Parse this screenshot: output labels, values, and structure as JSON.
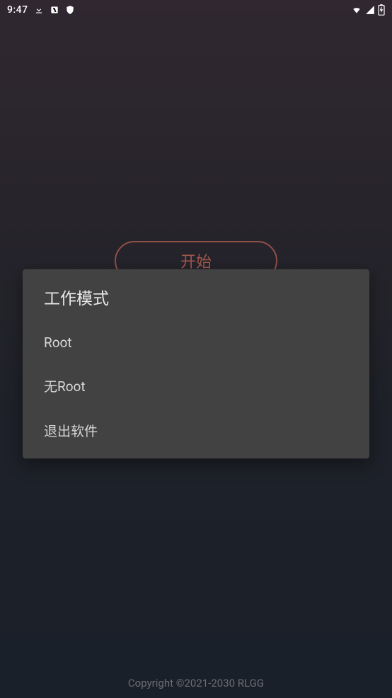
{
  "status_bar": {
    "time": "9:47"
  },
  "main": {
    "start_button_label": "开始"
  },
  "dialog": {
    "title": "工作模式",
    "items": [
      {
        "label": "Root"
      },
      {
        "label": "无Root"
      },
      {
        "label": "退出软件"
      }
    ]
  },
  "footer": {
    "copyright": "Copyright ©2021-2030 RLGG"
  }
}
